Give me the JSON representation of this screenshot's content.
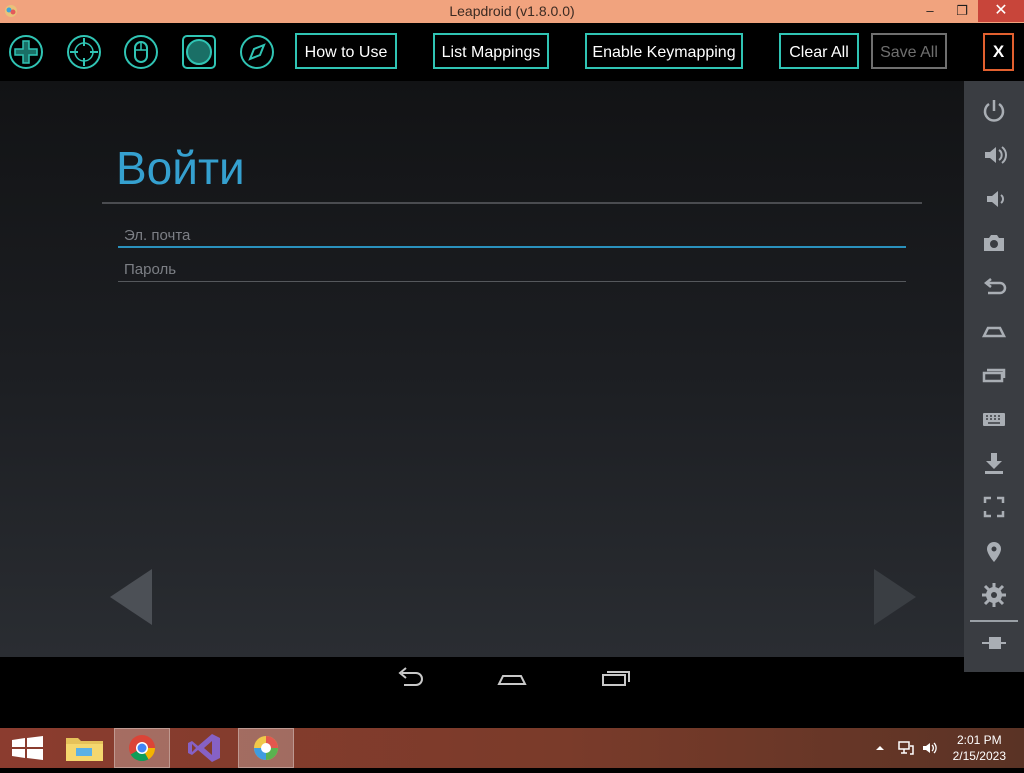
{
  "window": {
    "title": "Leapdroid (v1.8.0.0)",
    "minimize_glyph": "–",
    "restore_glyph": "❐",
    "close_glyph": "✕"
  },
  "toolbar": {
    "icons": [
      "dpad-icon",
      "crosshair-icon",
      "mouse-icon",
      "circle-button-icon",
      "compass-icon"
    ],
    "buttons": {
      "how_to_use": "How to Use",
      "list_mappings": "List Mappings",
      "enable_keymapping": "Enable Keymapping",
      "clear_all": "Clear All",
      "save_all": "Save All"
    },
    "close_label": "X"
  },
  "app": {
    "title": "Войти",
    "email_placeholder": "Эл. почта",
    "password_placeholder": "Пароль"
  },
  "side_panel": {
    "icons": [
      "power-icon",
      "volume-up-icon",
      "volume-down-icon",
      "camera-icon",
      "back-icon",
      "home-icon",
      "recent-apps-icon",
      "keyboard-icon",
      "download-icon",
      "fullscreen-icon",
      "location-icon",
      "settings-icon",
      "pin-icon"
    ]
  },
  "android_nav": [
    "back-icon",
    "home-icon",
    "recent-apps-icon"
  ],
  "taskbar": {
    "apps": [
      "start-icon",
      "file-explorer-icon",
      "chrome-icon",
      "visual-studio-icon",
      "leapdroid-icon"
    ],
    "time": "2:01 PM",
    "date": "2/15/2023"
  },
  "colors": {
    "accent": "#30c4b4",
    "title_blue": "#35a0cf",
    "close_orange": "#e2602f",
    "titlebar": "#f1a37e"
  }
}
